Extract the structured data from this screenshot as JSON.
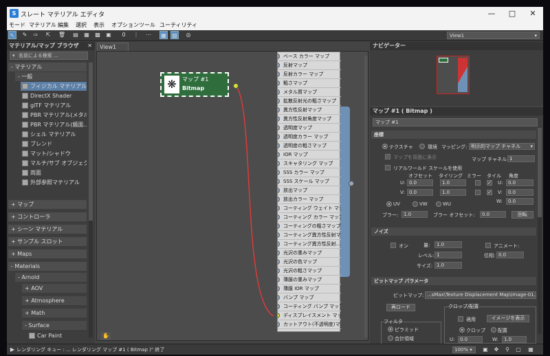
{
  "window": {
    "title": "スレート マテリアル エディタ",
    "app_icon": "3ds-max-icon"
  },
  "menu": [
    "モード",
    "マテリアル",
    "編集",
    "選択",
    "表示",
    "オプション",
    "ツール",
    "ユーティリティ"
  ],
  "toolbar": {
    "view_selector": "View1"
  },
  "left_panel": {
    "title": "マテリアル/マップ ブラウザ",
    "search_placeholder": "名前による検索 ...",
    "tree": {
      "materials_label": "- マテリアル",
      "general_label": "- 一般",
      "general_items": [
        "フィジカル マテリアル",
        "DirectX Shader",
        "glTF マテリアル",
        "PBR マテリアル(メタル ...",
        "PBR マテリアル(鏡面...",
        "シェル マテリアル",
        "ブレンド",
        "マット/シャドウ",
        "マルチ/サブ オブジェクト",
        "両面",
        "外部参照マテリアル"
      ],
      "selected_item": "フィジカル マテリアル",
      "categories": [
        "+ マップ",
        "+ コントローラ",
        "+ シーン マテリアル",
        "+ サンプル スロット",
        "+ Maps"
      ],
      "materials2_label": "- Materials",
      "arnold_label": "- Arnold",
      "arnold_items": [
        "+ AOV",
        "+ Atmosphere",
        "+ Math"
      ],
      "surface_label": "- Surface",
      "surface_item": "Car Paint"
    }
  },
  "view": {
    "tab": "View1",
    "bitmap_node": {
      "title": "マップ #1",
      "type": "Bitmap"
    },
    "slots": [
      "ベース カラー マップ",
      "反射マップ",
      "反射カラー マップ",
      "粗さマップ",
      "メタル質マップ",
      "拡散反射光の粗さマップ",
      "異方性反射マップ",
      "異方性反射角度マップ",
      "透明度マップ",
      "透明度カラー マップ",
      "透明度の粗さマップ",
      "IOR マップ",
      "スキャタリング マップ",
      "SSS カラー マップ",
      "SSS スケール マップ",
      "放出マップ",
      "放出カラー マップ",
      "コーティング ウェイト マップ",
      "コーティング カラー マップ",
      "コーティングの粗さマップ",
      "コーティング異方性反射マ...",
      "コーティング異方性反射...",
      "光沢の重みマップ",
      "光沢の色マップ",
      "光沢の粗さマップ",
      "薄膜の重みマップ",
      "薄膜 IOR マップ",
      "バンプ マップ",
      "コーティング バンプ マップ",
      "ディスプレイスメント マップ",
      "カットアウト(不透明度)マップ"
    ],
    "connected_slot": "ディスプレイスメント マップ"
  },
  "navigator": {
    "title": "ナビゲーター"
  },
  "properties": {
    "title": "マップ #1 ( Bitmap )",
    "name_value": "マップ #1",
    "coords": {
      "section": "座標",
      "texture_label": "テクスチャ",
      "env_label": "環境",
      "mapping_label": "マッピング:",
      "mapping_value": "明示的マップ チャネル",
      "show_on_back": "マップを背面に表示",
      "map_channel_label": "マップ チャネル:",
      "map_channel_value": "1",
      "realworld": "リアルワールド スケールを使用",
      "col_offset": "オフセット",
      "col_tiling": "タイリング",
      "col_mirror": "ミラー",
      "col_tile": "タイル",
      "col_angle": "角度",
      "u_label": "U:",
      "v_label": "V:",
      "w_label": "W:",
      "u_offset": "0.0",
      "v_offset": "0.0",
      "u_tiling": "1.0",
      "v_tiling": "1.0",
      "u_angle": "0.0",
      "v_angle": "0.0",
      "w_angle": "0.0",
      "uv": "UV",
      "vw": "VW",
      "wu": "WU",
      "blur_label": "ブラー:",
      "blur_value": "1.0",
      "blur_offset_label": "ブラー オフセット:",
      "blur_offset_value": "0.0",
      "rotate_button": "回転"
    },
    "noise": {
      "section": "ノイズ",
      "on_label": "オン",
      "amount_label": "量:",
      "amount_value": "1.0",
      "animate_label": "アニメート:",
      "levels_label": "レベル:",
      "levels_value": "1",
      "phase_label": "位相:",
      "phase_value": "0.0",
      "size_label": "サイズ:",
      "size_value": "1.0"
    },
    "bitmap_params": {
      "section": "ビットマップ パラメータ",
      "bitmap_label": "ビットマップ:",
      "bitmap_path": "...sMax\\Texture Displacement Map\\image-01.png",
      "reload_button": "再ロード",
      "crop_group": "クロップ/配置",
      "apply_label": "適用",
      "view_image_button": "イメージを表示",
      "crop_label": "クロップ",
      "place_label": "配置",
      "u_label": "U:",
      "u_value": "0.0",
      "w_label": "W:",
      "w_value": "1.0",
      "filter_group": "フィルタ",
      "pyramid_label": "ピラミッド",
      "summed_label": "合計領域"
    }
  },
  "status": {
    "text": "レンダリング キュー : ... レンダリング マップ #1 ( Bitmap )\" 終了",
    "zoom": "100%"
  }
}
